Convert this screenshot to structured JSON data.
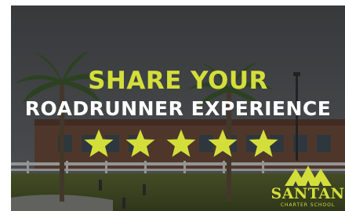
{
  "banner": {
    "headline_line1": "SHARE YOUR",
    "headline_line2": "ROADRUNNER EXPERIENCE",
    "star_count": 5,
    "star_icon": "star-icon"
  },
  "logo": {
    "name": "SANTAN",
    "subtitle": "CHARTER SCHOOL"
  },
  "colors": {
    "accent": "#d4de3a",
    "text": "#ffffff"
  }
}
